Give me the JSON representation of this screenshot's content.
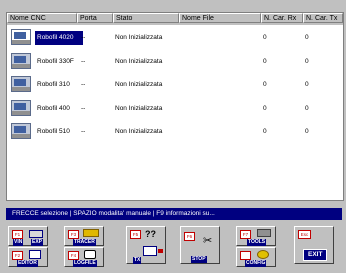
{
  "columns": [
    "Nome CNC",
    "Porta",
    "Stato",
    "Nome File",
    "N. Car. Rx",
    "N. Car. Tx"
  ],
  "rows": [
    {
      "name": "Robofil 4020",
      "port": "--",
      "status": "Non Inizializzata",
      "file": "",
      "rx": "0",
      "tx": "0",
      "selected": true
    },
    {
      "name": "Robofil 330F",
      "port": "--",
      "status": "Non Inizializzata",
      "file": "",
      "rx": "0",
      "tx": "0",
      "selected": false
    },
    {
      "name": "Robofil 310",
      "port": "--",
      "status": "Non Inizializzata",
      "file": "",
      "rx": "0",
      "tx": "0",
      "selected": false
    },
    {
      "name": "Robofil 400",
      "port": "--",
      "status": "Non Inizializzata",
      "file": "",
      "rx": "0",
      "tx": "0",
      "selected": false
    },
    {
      "name": "Robofil 510",
      "port": "--",
      "status": "Non Inizializzata",
      "file": "",
      "rx": "0",
      "tx": "0",
      "selected": false
    }
  ],
  "status_bar": "FRECCE  selezione | SPAZIO  modalita' manuale | F9 informazioni su...",
  "toolbar": {
    "f1": "F1",
    "f2": "F2",
    "f3": "F3",
    "f4": "F4",
    "f5": "F5",
    "f6": "F6",
    "f7": "F7",
    "esc": "Esc",
    "vin": "VIN",
    "exp": "EXP",
    "tracer": "TRACER",
    "editor": "EDITOR",
    "logfile": "LOGFILE",
    "qq": "??",
    "tx": "TX",
    "stop": "STOP",
    "tools": "TOOLS",
    "config": "CONFIG",
    "exit": "EXIT"
  },
  "colors": {
    "accent": "#000080",
    "panel": "#c0c0c0",
    "function_key": "#c00000"
  }
}
